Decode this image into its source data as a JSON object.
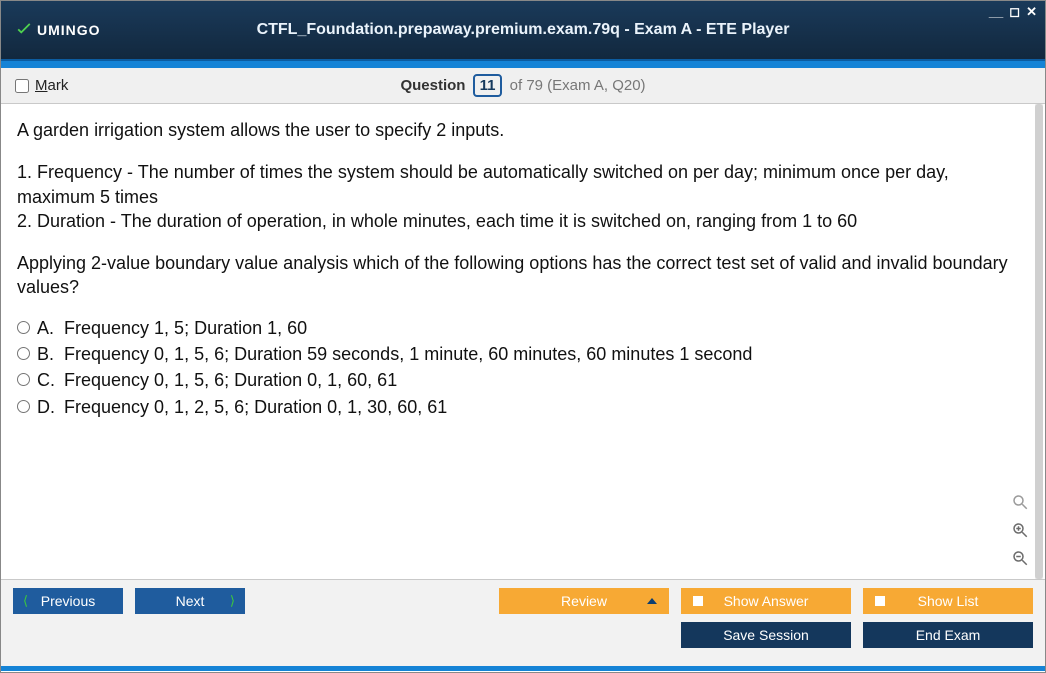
{
  "window": {
    "title": "CTFL_Foundation.prepaway.premium.exam.79q - Exam A - ETE Player",
    "brand": "UMINGO"
  },
  "infobar": {
    "mark_label": "Mark",
    "question_label": "Question",
    "current": "11",
    "total_suffix": " of 79 (Exam A, Q20)"
  },
  "question": {
    "intro": "A garden irrigation system allows the user to specify 2 inputs.",
    "line1": "1. Frequency - The number of times the system should be automatically switched on per day; minimum once per day, maximum 5 times",
    "line2": "2. Duration - The duration of operation, in whole minutes, each time it is switched on, ranging from 1 to 60",
    "prompt": "Applying 2-value boundary value analysis which of the following options has the correct test set of valid and invalid boundary values?"
  },
  "options": [
    {
      "letter": "A.",
      "text": "Frequency 1, 5; Duration 1, 60"
    },
    {
      "letter": "B.",
      "text": "Frequency 0, 1, 5, 6; Duration 59 seconds, 1 minute, 60 minutes, 60 minutes 1 second"
    },
    {
      "letter": "C.",
      "text": "Frequency 0, 1, 5, 6; Duration 0, 1, 60, 61"
    },
    {
      "letter": "D.",
      "text": "Frequency 0, 1, 2, 5, 6; Duration 0, 1, 30, 60, 61"
    }
  ],
  "buttons": {
    "previous": "Previous",
    "next": "Next",
    "review": "Review",
    "show_answer": "Show Answer",
    "show_list": "Show List",
    "save_session": "Save Session",
    "end_exam": "End Exam"
  }
}
